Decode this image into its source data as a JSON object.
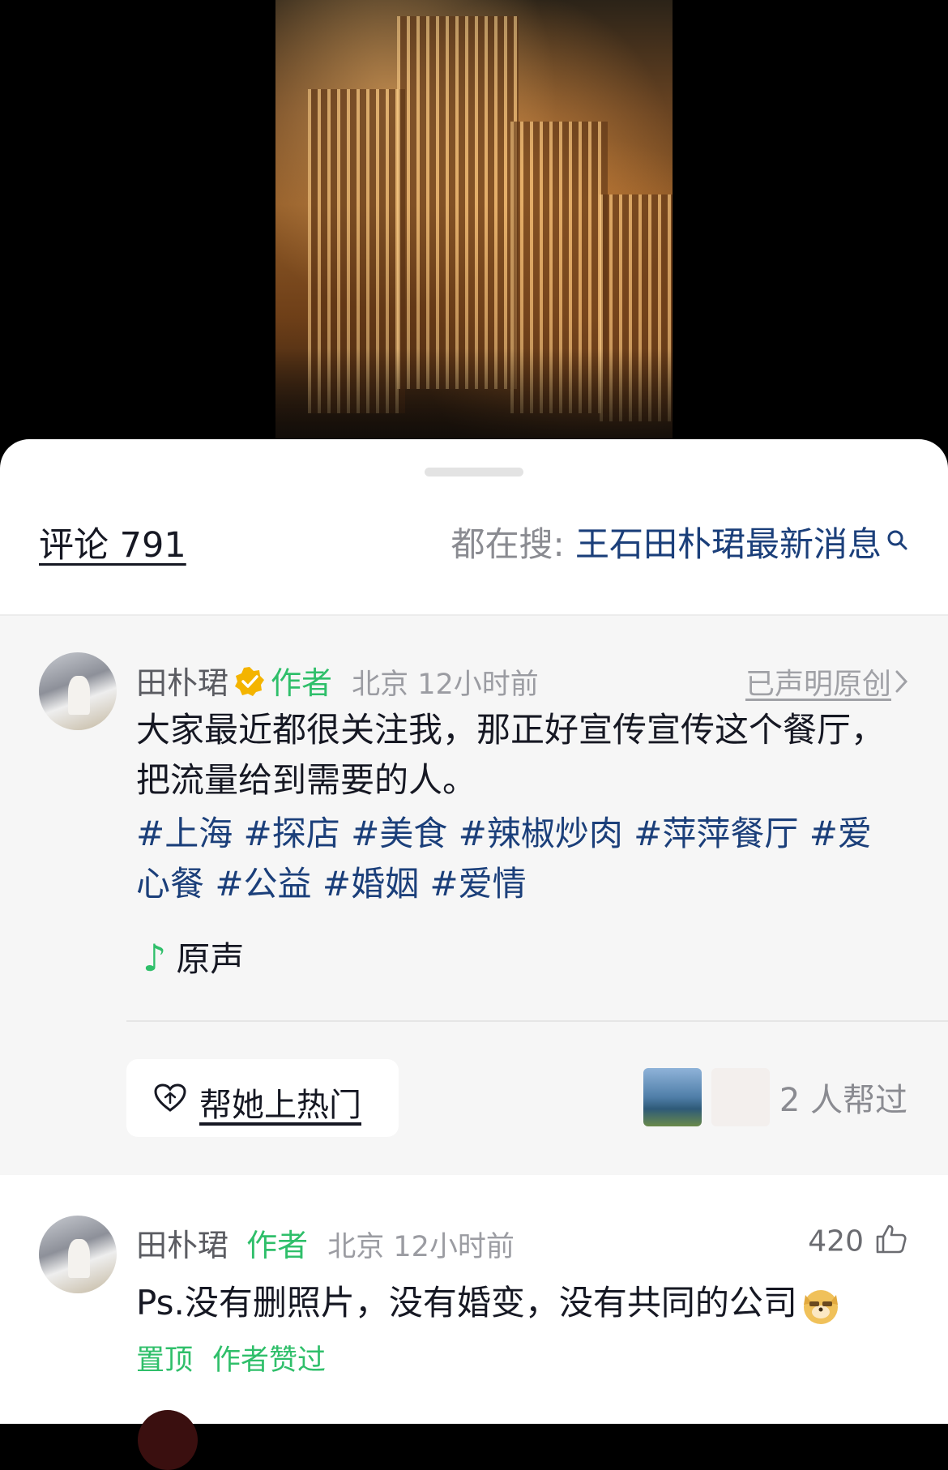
{
  "header": {
    "comment_count": "评论 791",
    "search_prefix": "都在搜: ",
    "search_term": "王石田朴珺最新消息"
  },
  "pinned_post": {
    "author": "田朴珺",
    "badge": "作者",
    "location_time": "北京 12小时前",
    "original_label": "已声明原创",
    "text": "大家最近都很关注我，那正好宣传宣传这个餐厅，把流量给到需要的人。",
    "hashtags": "#上海 #探店 #美食 #辣椒炒肉 #萍萍餐厅 #爱心餐 #公益 #婚姻 #爱情",
    "music": "原声",
    "boost_label": "帮她上热门",
    "helpers_text": "2 人帮过"
  },
  "comment": {
    "author": "田朴珺",
    "badge": "作者",
    "location_time": "北京 12小时前",
    "likes": "420",
    "text": "Ps.没有删照片，没有婚变，没有共同的公司",
    "tag_pinned": "置顶",
    "tag_author_liked": "作者赞过"
  },
  "colors": {
    "accent_green": "#2fbf6a",
    "link_blue": "#1b3f7a",
    "verified_gold": "#f4b400"
  },
  "icons": [
    "search-icon",
    "verified-icon",
    "chevron-right-icon",
    "music-note-icon",
    "heart-boost-icon",
    "thumbs-up-icon",
    "doge-emoji-icon"
  ]
}
